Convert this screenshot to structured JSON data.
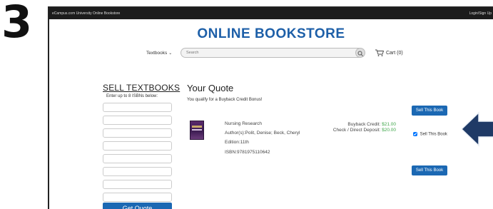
{
  "step_number": "3",
  "topbar": {
    "site_name": "eCampus.com University Online Bookstore",
    "login": "Login/Sign Up"
  },
  "header": {
    "title": "ONLINE BOOKSTORE",
    "category_select": "Textbooks",
    "search_placeholder": "Search",
    "cart": "Cart (0)"
  },
  "sell_panel": {
    "title": "SELL TEXTBOOKS",
    "subtitle": "Enter up to 8 ISBNs below:",
    "isbn_fields": [
      "",
      "",
      "",
      "",
      "",
      "",
      "",
      ""
    ],
    "button": "Get Quote"
  },
  "quote": {
    "title": "Your Quote",
    "bonus_text": "You qualify for a Buyback Credit Bonus!",
    "sell_button": "Sell This Book",
    "book": {
      "title": "Nursing Research",
      "authors": "Author(s):Polit, Denise; Beck, Cheryl",
      "edition": "Edition:11th",
      "isbn": "ISBN:9781975110642",
      "buyback_label": "Buyback Credit:",
      "buyback_value": "$21.00",
      "deposit_label": "Check / Direct Deposit:",
      "deposit_value": "$20.00",
      "sell_checkbox_label": "Sell This Book",
      "sell_checked": true
    }
  },
  "colors": {
    "brand_blue": "#1d5fa8",
    "button_blue": "#1b68b3",
    "price_green": "#3fa64a",
    "arrow_navy": "#1f3a66"
  }
}
